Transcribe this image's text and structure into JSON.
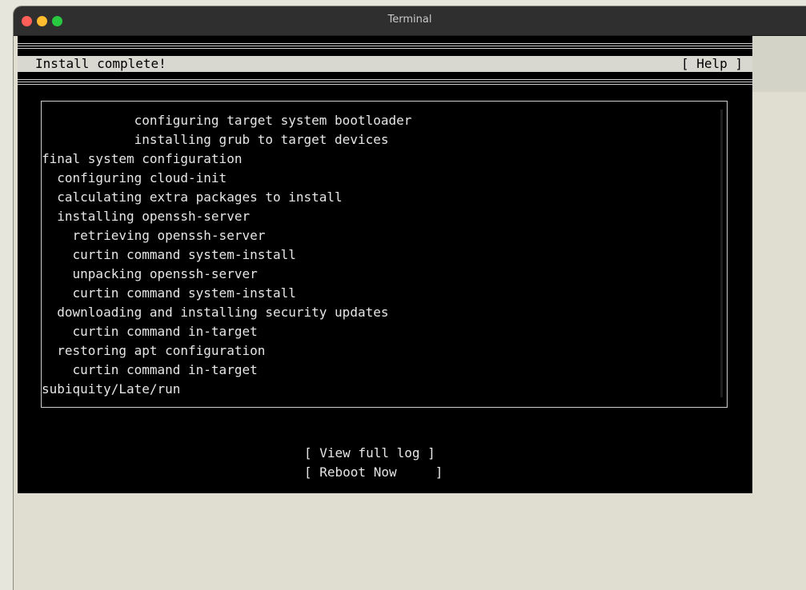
{
  "window": {
    "title": "Terminal"
  },
  "header": {
    "title": "Install complete!",
    "help": "[ Help ]"
  },
  "log": {
    "lines": [
      "            configuring target system bootloader",
      "            installing grub to target devices",
      "final system configuration",
      "  configuring cloud-init",
      "  calculating extra packages to install",
      "  installing openssh-server",
      "    retrieving openssh-server",
      "    curtin command system-install",
      "    unpacking openssh-server",
      "    curtin command system-install",
      "  downloading and installing security updates",
      "    curtin command in-target",
      "  restoring apt configuration",
      "    curtin command in-target",
      "subiquity/Late/run"
    ]
  },
  "buttons": {
    "view_log": "[ View full log ]",
    "reboot": "[ Reboot Now     ]"
  },
  "colors": {
    "terminal_bg": "#000000",
    "terminal_fg": "#e6e6e6",
    "header_bg": "#d8d8d0",
    "window_bg": "#dfded0"
  }
}
